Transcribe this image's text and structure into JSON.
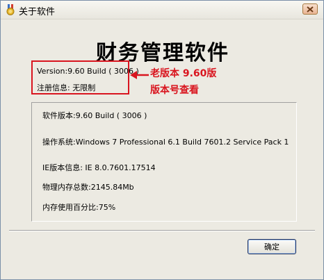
{
  "window": {
    "title": "关于软件"
  },
  "main": {
    "product_name": "财务管理软件",
    "version_line": "Version:9.60 Build ( 3006 )",
    "registration_line": "注册信息: 无限制",
    "annotation": {
      "line1": "老版本 9.60版",
      "line2": "版本号查看",
      "color": "#d9151f"
    }
  },
  "details": {
    "software_version": "软件版本:9.60 Build ( 3006 )",
    "os": "操作系统:Windows 7 Professional  6.1 Build 7601.2 Service Pack 1",
    "ie_version": "IE版本信息: IE 8.0.7601.17514",
    "total_memory": "物理内存总数:2145.84Mb",
    "memory_usage": "内存使用百分比:75%"
  },
  "buttons": {
    "ok_label": "确定"
  },
  "icons": {
    "app": "medal-icon",
    "close": "close-icon",
    "arrow": "arrow-left-icon"
  }
}
